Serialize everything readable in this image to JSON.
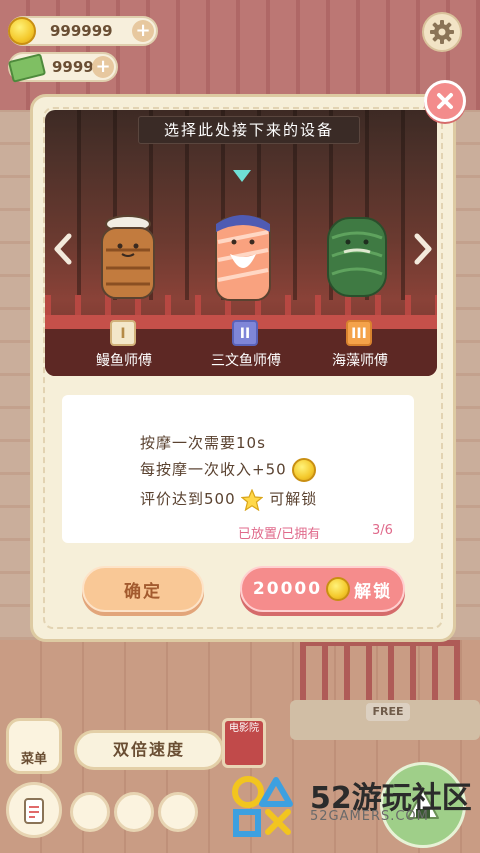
{
  "hud": {
    "coins": "999999",
    "cash": "9999"
  },
  "modal": {
    "title": "选择此处接下来的设备",
    "characters": [
      {
        "numeral": "I",
        "name": "鳗鱼师傅",
        "badge_color": "#f3e7c9",
        "badge_text": "#b48a46"
      },
      {
        "numeral": "II",
        "name": "三文鱼师傅",
        "badge_color": "#7f86d8",
        "badge_text": "#ffffff"
      },
      {
        "numeral": "III",
        "name": "海藻师傅",
        "badge_color": "#f4a24a",
        "badge_text": "#ffffff"
      }
    ],
    "selected_index": 1,
    "info": {
      "line1": "按摩一次需要10s",
      "line2": "每按摩一次收入+50",
      "line3_prefix": "评价达到500",
      "line3_suffix": "可解锁",
      "status_label": "已放置/已拥有",
      "status_count": "3/6"
    },
    "confirm_label": "确定",
    "unlock_price": "20000",
    "unlock_label": "解锁"
  },
  "bottom": {
    "menu_label": "菜单",
    "speed_label": "双倍速度",
    "free_label": "FREE",
    "poster_label": "电影院"
  },
  "watermark": {
    "title": "52游玩社区",
    "site": "52GAMERS.COM"
  },
  "colors": {
    "accent_red": "#f58c8c",
    "accent_peach": "#f9c896",
    "stage_bg": "#6b3a30",
    "selection_marker": "#6fe0d6"
  }
}
